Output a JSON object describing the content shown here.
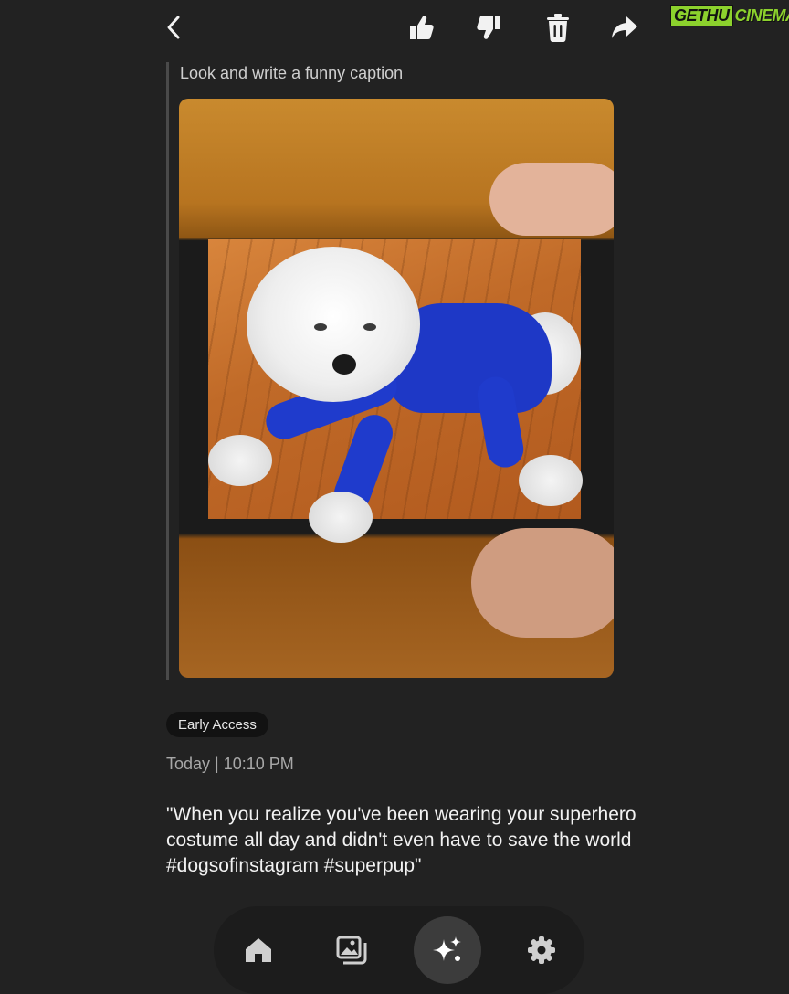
{
  "header": {
    "back_icon": "chevron-left-icon",
    "like_icon": "thumbs-up-icon",
    "dislike_icon": "thumbs-down-icon",
    "delete_icon": "trash-icon",
    "share_icon": "share-arrow-icon"
  },
  "watermark": {
    "part1": "GETHU",
    "part2": "CINEMA",
    "color": "#8cd12d"
  },
  "conversation": {
    "prompt": "Look and write a funny caption",
    "image_alt": "Photo of a phone screen showing a white fluffy dog wearing a blue bodysuit on a wooden floor",
    "badge": "Early Access",
    "timestamp": "Today | 10:10 PM",
    "response": "\"When you realize you've been wearing your superhero costume all day and didn't even have to save the world #dogsofinstagram #superpup\""
  },
  "bottom_nav": {
    "items": [
      {
        "icon": "home-icon",
        "active": false
      },
      {
        "icon": "gallery-icon",
        "active": false
      },
      {
        "icon": "sparkle-ai-icon",
        "active": true
      },
      {
        "icon": "settings-gear-icon",
        "active": false
      }
    ]
  },
  "colors": {
    "background": "#222222",
    "badge_bg": "#121212",
    "nav_bg": "#1c1c1c"
  }
}
